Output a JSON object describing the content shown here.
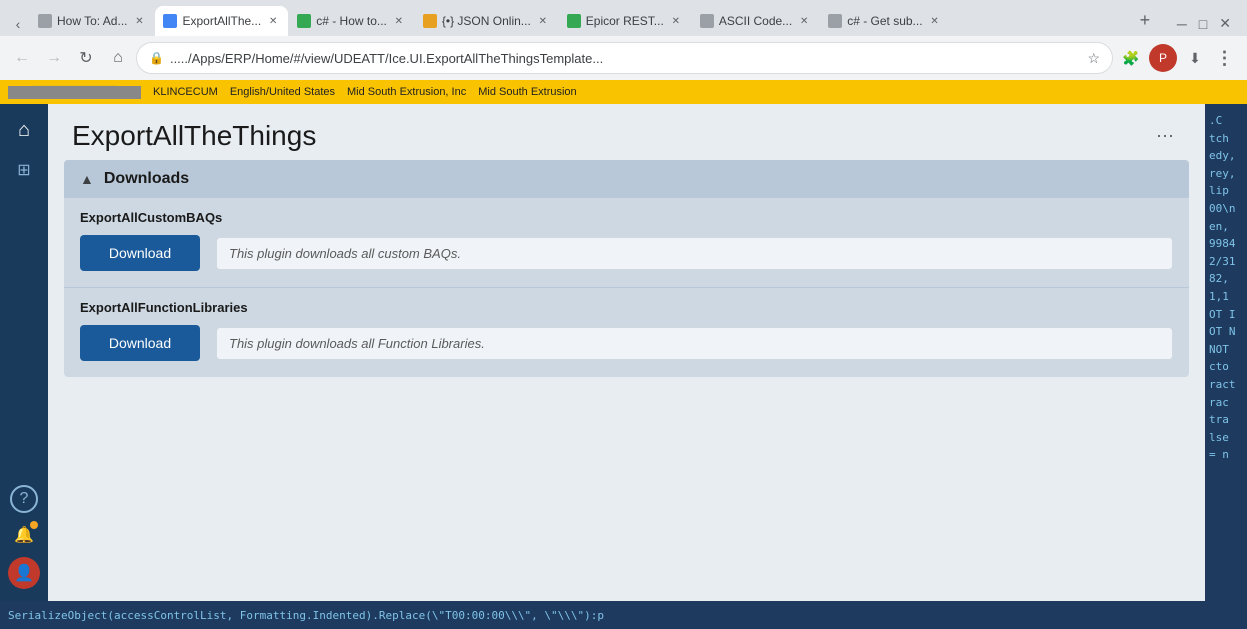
{
  "browser": {
    "tabs": [
      {
        "id": "tab1",
        "label": "How To: Ad...",
        "active": false,
        "favicon_color": "#9aa0a6"
      },
      {
        "id": "tab2",
        "label": "ExportAllThe...",
        "active": true,
        "favicon_color": "#4285f4"
      },
      {
        "id": "tab3",
        "label": "c# - How to...",
        "active": false,
        "favicon_color": "#34a853"
      },
      {
        "id": "tab4",
        "label": "{•} JSON Onlin...",
        "active": false,
        "favicon_color": "#e8a020"
      },
      {
        "id": "tab5",
        "label": "Epicor REST...",
        "active": false,
        "favicon_color": "#34a853"
      },
      {
        "id": "tab6",
        "label": "ASCII Code...",
        "active": false,
        "favicon_color": "#9aa0a6"
      },
      {
        "id": "tab7",
        "label": "c# - Get sub...",
        "active": false,
        "favicon_color": "#9aa0a6"
      }
    ],
    "address": "...../Apps/ERP/Home/#/view/UDEATT/Ice.UI.ExportAllTheThingsTemplate...",
    "new_tab_label": "+"
  },
  "top_bar": {
    "items": [
      "KLINCECUM",
      "English/United States",
      "Mid South Extrusion, Inc",
      "Mid South Extrusion"
    ]
  },
  "sidebar": {
    "icons": [
      {
        "name": "home-icon",
        "symbol": "⌂",
        "active": true
      },
      {
        "name": "grid-icon",
        "symbol": "⊞",
        "active": false
      }
    ],
    "bottom_icons": [
      {
        "name": "help-icon",
        "symbol": "?"
      },
      {
        "name": "notification-icon",
        "symbol": "🔔",
        "badge": true
      },
      {
        "name": "user-icon",
        "symbol": "👤"
      }
    ]
  },
  "page": {
    "title": "ExportAllTheThings",
    "more_actions_label": "⋯"
  },
  "downloads_section": {
    "title": "Downloads",
    "collapse_icon": "▲",
    "items": [
      {
        "id": "item1",
        "label": "ExportAllCustomBAQs",
        "button_label": "Download",
        "description": "This plugin downloads all custom BAQs."
      },
      {
        "id": "item2",
        "label": "ExportAllFunctionLibraries",
        "button_label": "Download",
        "description": "This plugin downloads all Function Libraries."
      }
    ]
  },
  "right_panel": {
    "code_lines": [
      ".C",
      "tch",
      "edy,",
      "rey,",
      "lip",
      "00\\n",
      "en,",
      "9984",
      "2/31",
      "82,",
      "1,1",
      "OT I",
      "OT N",
      "NOT",
      "cto",
      "ract",
      "rac",
      "tra",
      "lse",
      "= n"
    ]
  },
  "bottom_bar": {
    "code": "SerializeObject(accessControlList, Formatting.Indented).Replace(\\\"T00:00:00\\\\\\\", \\\"\\\\\\\"):p"
  }
}
